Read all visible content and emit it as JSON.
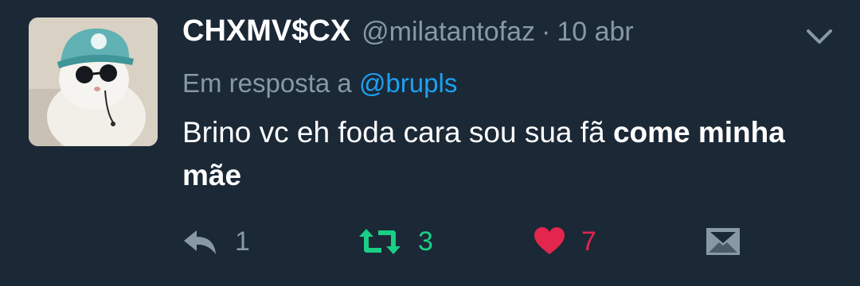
{
  "tweet": {
    "display_name": "CHXMV$CX",
    "handle": "@milatantofaz",
    "separator": "·",
    "date": "10 abr",
    "reply_prefix": "Em resposta a",
    "reply_to": "@brupls",
    "text_normal": "Brino vc eh foda cara sou sua fã ",
    "text_bold": "come minha mãe"
  },
  "actions": {
    "reply_count": "1",
    "retweet_count": "3",
    "like_count": "7"
  },
  "icons": {
    "menu": "chevron-down-icon",
    "reply": "reply-arrow-icon",
    "retweet": "retweet-icon",
    "like": "heart-icon",
    "message": "envelope-icon"
  },
  "colors": {
    "background": "#1b2836",
    "name": "#ffffff",
    "muted": "#8899a6",
    "mention": "#1da1f2",
    "retweet": "#19cf86",
    "like": "#e2264d"
  }
}
